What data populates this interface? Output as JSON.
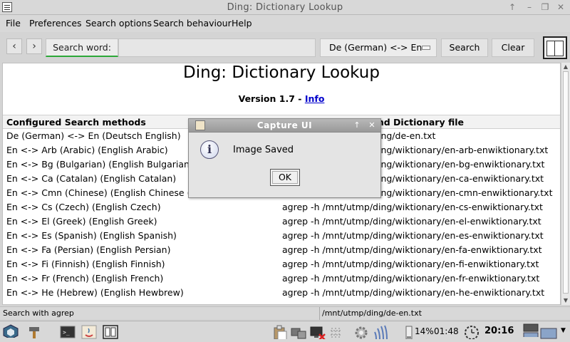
{
  "window": {
    "title": "Ding: Dictionary Lookup"
  },
  "menu": {
    "file": "File",
    "preferences": "Preferences",
    "search_options": "Search options",
    "search_behaviour": "Search behaviour",
    "help": "Help"
  },
  "toolbar": {
    "back_glyph": "‹",
    "forward_glyph": "›",
    "search_word_label": "Search word:",
    "search_value": "",
    "language": "De (German) <-> En",
    "search_button": "Search",
    "clear_button": "Clear"
  },
  "content": {
    "heading": "Ding: Dictionary Lookup",
    "version": "Version 1.7  -",
    "info_link": "Info",
    "col1": "Configured Search methods",
    "col2": "Search command and Dictionary file",
    "rows": [
      {
        "method": "De (German) <-> En (Deutsch English)",
        "command": "agrep -h /mnt/utmp/ding/de-en.txt"
      },
      {
        "method": "En <-> Arb (Arabic) (English Arabic)",
        "command": "agrep -h /mnt/utmp/ding/wiktionary/en-arb-enwiktionary.txt"
      },
      {
        "method": "En <-> Bg (Bulgarian) (English Bulgarian)",
        "command": "agrep -h /mnt/utmp/ding/wiktionary/en-bg-enwiktionary.txt"
      },
      {
        "method": "En <-> Ca (Catalan) (English Catalan)",
        "command": "agrep -h /mnt/utmp/ding/wiktionary/en-ca-enwiktionary.txt"
      },
      {
        "method": "En <-> Cmn (Chinese) (English Chinese (Mandarin))",
        "command": "agrep -h /mnt/utmp/ding/wiktionary/en-cmn-enwiktionary.txt"
      },
      {
        "method": "En <-> Cs (Czech) (English Czech)",
        "command": "agrep -h /mnt/utmp/ding/wiktionary/en-cs-enwiktionary.txt"
      },
      {
        "method": "En <-> El (Greek) (English Greek)",
        "command": "agrep -h /mnt/utmp/ding/wiktionary/en-el-enwiktionary.txt"
      },
      {
        "method": "En <-> Es (Spanish) (English Spanish)",
        "command": "agrep -h /mnt/utmp/ding/wiktionary/en-es-enwiktionary.txt"
      },
      {
        "method": "En <-> Fa (Persian) (English Persian)",
        "command": "agrep -h /mnt/utmp/ding/wiktionary/en-fa-enwiktionary.txt"
      },
      {
        "method": "En <-> Fi (Finnish) (English Finnish)",
        "command": "agrep -h /mnt/utmp/ding/wiktionary/en-fi-enwiktionary.txt"
      },
      {
        "method": "En <-> Fr (French) (English French)",
        "command": "agrep -h /mnt/utmp/ding/wiktionary/en-fr-enwiktionary.txt"
      },
      {
        "method": "En <-> He (Hebrew) (English Hewbrew)",
        "command": "agrep -h /mnt/utmp/ding/wiktionary/en-he-enwiktionary.txt"
      }
    ]
  },
  "status": {
    "left": "Search with agrep",
    "right": "/mnt/utmp/ding/de-en.txt"
  },
  "dialog": {
    "title": "Capture UI",
    "message": "Image Saved",
    "ok": "OK"
  },
  "taskbar": {
    "battery": "14%",
    "battery_time": "01:48",
    "clock": "20:16"
  }
}
